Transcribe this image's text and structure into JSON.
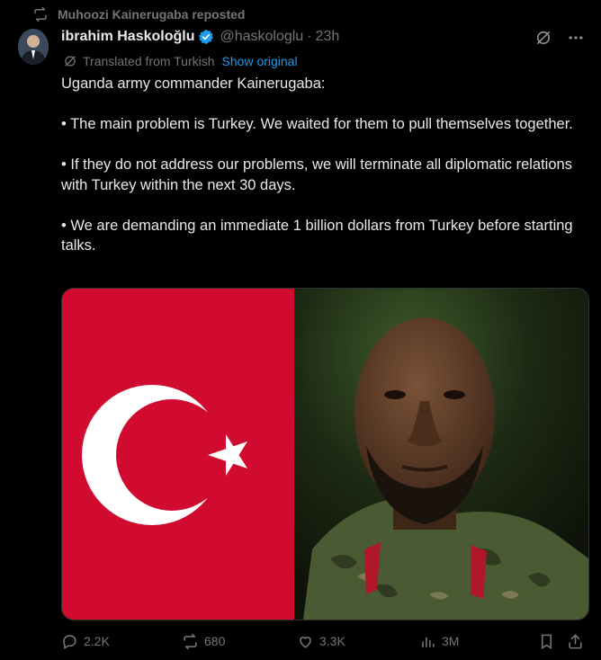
{
  "repost": {
    "icon": "repost-icon",
    "text": "Muhoozi Kainerugaba reposted"
  },
  "author": {
    "name": "ibrahim Haskoloğlu",
    "handle": "@haskologlu",
    "separator": "·",
    "time": "23h"
  },
  "translation": {
    "label": "Translated from Turkish",
    "link": "Show original"
  },
  "tweet": {
    "lines": [
      "Uganda army commander Kainerugaba:",
      "• The main problem is Turkey. We waited for them to pull themselves together.",
      "• If they do not address our problems, we will terminate all diplomatic relations with Turkey within the next 30 days.",
      "• We are demanding an immediate 1 billion dollars from Turkey before starting talks."
    ]
  },
  "engagement": {
    "replies": "2.2K",
    "reposts": "680",
    "likes": "3.3K",
    "views": "3M"
  },
  "colors": {
    "accent": "#1d9bf0",
    "muted": "#71767b",
    "flag_red": "#d10b2f"
  }
}
